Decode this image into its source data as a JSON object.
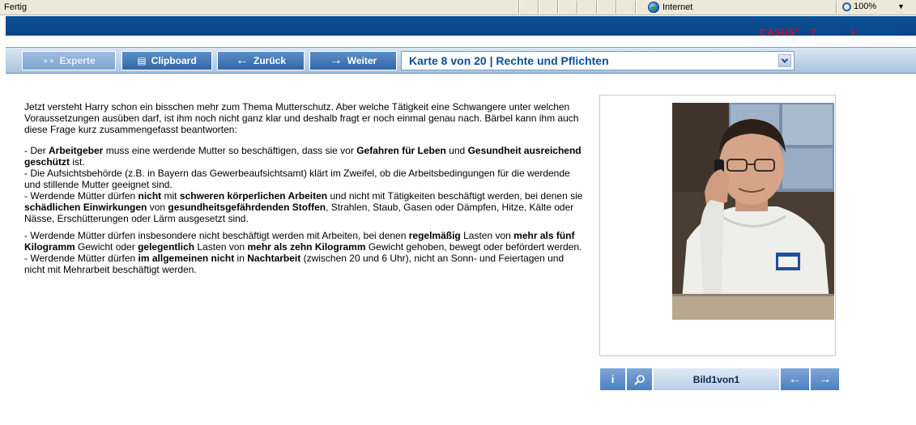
{
  "statusbar": {
    "status_text": "Fertig",
    "zone_label": "Internet",
    "zoom_label": "100%"
  },
  "header": {
    "brand": "CASUS",
    "brand_mark": "®",
    "help_qm": "?",
    "help_label": "Hilfe",
    "close_x": "×",
    "close_label": "Beenden"
  },
  "toolbar": {
    "expert_label": "Experte",
    "clipboard_label": "Clipboard",
    "back_label": "Zurück",
    "next_label": "Weiter",
    "card_select": "Karte 8 von 20 | Rechte und Pflichten"
  },
  "content": {
    "intro": "Jetzt versteht Harry schon ein bisschen mehr zum Thema Mutterschutz. Aber welche Tätigkeit eine Schwangere unter welchen Voraussetzungen ausüben darf, ist ihm noch nicht ganz klar und deshalb fragt er noch einmal genau nach. Bärbel kann ihm auch diese Frage kurz zusammengefasst beantworten:",
    "p1_a": "- Der ",
    "p1_b": "Arbeitgeber",
    "p1_c": " muss eine werdende Mutter so beschäftigen, dass sie vor ",
    "p1_d": "Gefahren für Leben",
    "p1_e": " und ",
    "p1_f": "Gesundheit ausreichend geschützt",
    "p1_g": " ist.",
    "p2": "- Die Aufsichtsbehörde (z.B. in Bayern das Gewerbeaufsichtsamt) klärt im Zweifel, ob die Arbeitsbedingungen für die werdende und stillende Mutter geeignet sind.",
    "p3_a": "- Werdende Mütter dürfen ",
    "p3_b": "nicht",
    "p3_c": " mit ",
    "p3_d": "schweren körperlichen Arbeiten",
    "p3_e": " und nicht mit Tätigkeiten beschäftigt werden, bei denen sie ",
    "p3_f": "schädlichen Einwirkungen",
    "p3_g": " von ",
    "p3_h": "gesundheitsgefährdenden Stoffen",
    "p3_i": ", Strahlen, Staub, Gasen oder Dämpfen, Hitze, Kälte oder Nässe, Erschütterungen oder Lärm ausgesetzt sind.",
    "p4_a": "- Werdende Mütter dürfen insbesondere nicht beschäftigt werden mit Arbeiten, bei denen ",
    "p4_b": "regelmäßig",
    "p4_c": " Lasten von ",
    "p4_d": "mehr als fünf Kilogramm",
    "p4_e": " Gewicht oder ",
    "p4_f": "gelegentlich",
    "p4_g": " Lasten von ",
    "p4_h": "mehr als zehn Kilogramm",
    "p4_i": " Gewicht gehoben, bewegt oder befördert werden.",
    "p5_a": "- Werdende Mütter dürfen ",
    "p5_b": "im allgemeinen nicht",
    "p5_c": " in ",
    "p5_d": "Nachtarbeit",
    "p5_e": " (zwischen 20 und 6 Uhr), nicht an Sonn- und Feiertagen und nicht mit Mehrarbeit beschäftigt werden."
  },
  "image_nav": {
    "info_label": "i",
    "bild_prefix": "Bild ",
    "bild_current": "1",
    "bild_middle": " von ",
    "bild_total": "1"
  }
}
